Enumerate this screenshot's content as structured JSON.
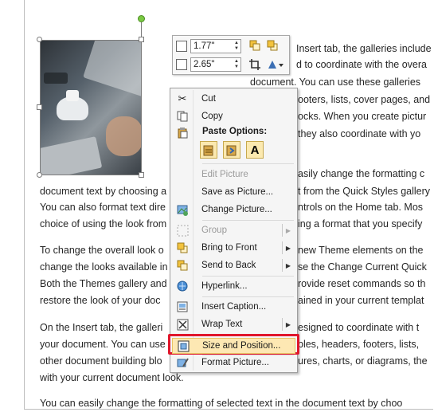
{
  "document": {
    "right_lines": [
      "Insert tab, the galleries include",
      "d to coordinate with the overa",
      "document. You can use these galleries",
      "ooters, lists, cover pages, and",
      "ocks. When you create pictur",
      "they also coordinate with yo",
      "asily change the formatting c"
    ],
    "para1": [
      "document text by choosing a",
      "You can also format text dire",
      "choice of using the look from"
    ],
    "para1_right": [
      "t from the Quick Styles gallery",
      "ntrols on the Home tab. Mos",
      "ing a format that you specify"
    ],
    "para2": [
      "To change the overall look o",
      "change the looks available in",
      "Both the Themes gallery and",
      "restore the look of your doc"
    ],
    "para2_right": [
      "new Theme elements on the",
      "se the Change Current Quick",
      "rovide reset commands so th",
      "ained in your current templat"
    ],
    "para3": [
      "On the Insert tab, the galleri",
      "your document. You can use",
      "other document building blo",
      "with your current document look."
    ],
    "para3_right": [
      "esigned to coordinate with t",
      "bles, headers, footers, lists,",
      "ures, charts, or diagrams, the",
      ""
    ],
    "last_line": "You can easily change the formatting of selected text in the document text by choo"
  },
  "minibar": {
    "height_value": "1.77\"",
    "width_value": "2.65\""
  },
  "menu": {
    "cut": "Cut",
    "copy": "Copy",
    "paste_options": "Paste Options:",
    "edit_picture": "Edit Picture",
    "save_as_picture": "Save as Picture...",
    "change_picture": "Change Picture...",
    "group": "Group",
    "bring_to_front": "Bring to Front",
    "send_to_back": "Send to Back",
    "hyperlink": "Hyperlink...",
    "insert_caption": "Insert Caption...",
    "wrap_text": "Wrap Text",
    "size_and_position": "Size and Position...",
    "format_picture": "Format Picture..."
  },
  "colors": {
    "highlight_border": "#e0162b",
    "hover_fill": "#fde8b3",
    "rotation_handle": "#7ac943"
  }
}
